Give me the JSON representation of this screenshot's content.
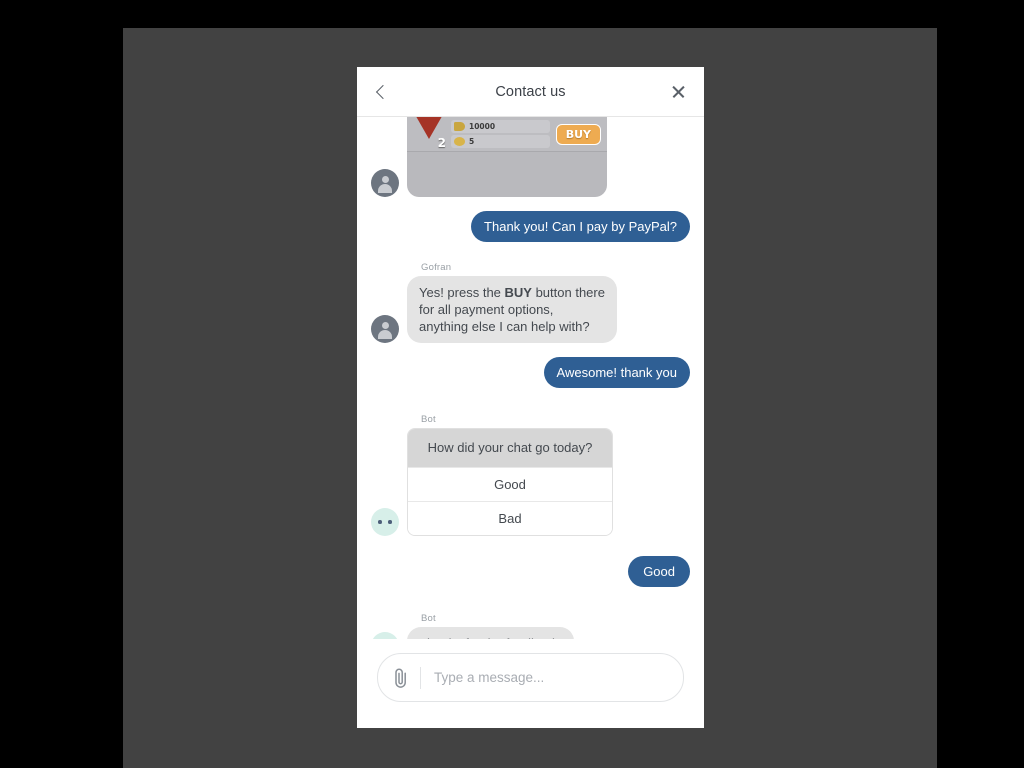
{
  "window": {
    "backdrop_color": "#424242",
    "outer_color": "#000000"
  },
  "header": {
    "title": "Contact us",
    "back_icon": "chevron-left-icon",
    "close_icon": "close-icon"
  },
  "theme": {
    "outgoing_bubble": "#2f5f94",
    "incoming_bubble": "#e4e4e4",
    "bot_avatar": "#d7efe9",
    "agent_avatar": "#6d7580",
    "survey_header": "#d6d6d6",
    "buy_button": "#eeab51"
  },
  "conversation": [
    {
      "id": "msg-image-attachment",
      "side": "left",
      "sender": "",
      "type": "image",
      "avatar": "agent",
      "game_card": {
        "level_badge": "2",
        "cost_primary": "10000",
        "cost_secondary": "5",
        "buy_label": "BUY"
      }
    },
    {
      "id": "msg-paypal-question",
      "side": "right",
      "type": "text",
      "text": "Thank you! Can I pay by PayPal?"
    },
    {
      "id": "msg-agent-answer",
      "side": "left",
      "sender": "Gofran",
      "type": "rich",
      "avatar": "agent",
      "line1_pre": "Yes! press the ",
      "line1_bold": "BUY",
      "line1_post": " button there",
      "line2": "for all payment options,",
      "line3": "anything else I can help with?"
    },
    {
      "id": "msg-awesome",
      "side": "right",
      "type": "text",
      "text": "Awesome! thank you"
    },
    {
      "id": "msg-survey",
      "side": "left",
      "sender": "Bot",
      "type": "survey",
      "avatar": "bot",
      "question": "How did your chat go today?",
      "options": [
        "Good",
        "Bad"
      ]
    },
    {
      "id": "msg-survey-answer",
      "side": "right",
      "type": "text",
      "text": "Good"
    },
    {
      "id": "msg-feedback-thanks",
      "side": "left",
      "sender": "Bot",
      "type": "text",
      "avatar": "bot",
      "text": "Thanks for the feedback."
    }
  ],
  "composer": {
    "attach_icon": "paperclip-icon",
    "placeholder": "Type a message...",
    "value": ""
  }
}
